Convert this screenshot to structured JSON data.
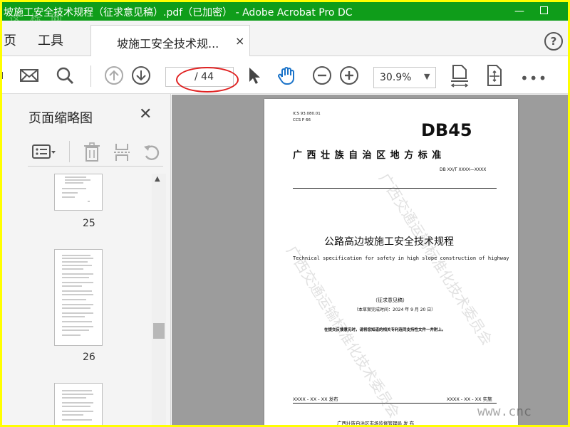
{
  "window": {
    "title": "坡施工安全技术规程（征求意见稿）.pdf（已加密） - Adobe Acrobat Pro DC",
    "minimize_glyph": "—",
    "overlay_watermark": "这 标 网"
  },
  "nav": {
    "home_label": "页",
    "tools_label": "工具",
    "doc_tab_label": "坡施工安全技术规...",
    "doc_tab_close": "×",
    "help_label": "?"
  },
  "toolbar": {
    "icons": [
      "mail-icon",
      "search-icon",
      "page-up-icon",
      "page-down-icon",
      "select-arrow-icon",
      "hand-icon",
      "zoom-out-icon",
      "zoom-in-icon",
      "fit-page-icon",
      "rotate-icon",
      "more-icon"
    ],
    "page_input_value": "",
    "page_total": "/ 44",
    "zoom_value": "30.9%",
    "more_label": "•••"
  },
  "left_panel": {
    "title": "页面缩略图",
    "close_glyph": "✕",
    "thumbnails": [
      {
        "page": "25"
      },
      {
        "page": "26"
      },
      {
        "page": ""
      }
    ]
  },
  "pdf_page": {
    "ics": "ICS  93.080.01",
    "ccs": "CCS  P 66",
    "logo": "DB45",
    "region_title": "广 西 壮 族 自 治 区 地 方 标 准",
    "std_number": "DB XX/T XXXX—XXXX",
    "title_cn": "公路高边坡施工安全技术规程",
    "title_en": "Technical specification for safety in high slope construction of highway",
    "draft_label": "（征求意见稿）",
    "draft_date": "（本草案完成时间：2024 年 9 月 20 日）",
    "notice": "在提交反馈意见时，请将您知道的相关专利连同支持性文件一并附上。",
    "issued": "XXXX - XX - XX 发布",
    "implemented": "XXXX - XX - XX 实施",
    "publisher": "广西壮族自治区市场监督管理局    发 布",
    "watermark_text": "广西交通运输标准化技术委员会"
  },
  "site_watermark": "www.cnc"
}
